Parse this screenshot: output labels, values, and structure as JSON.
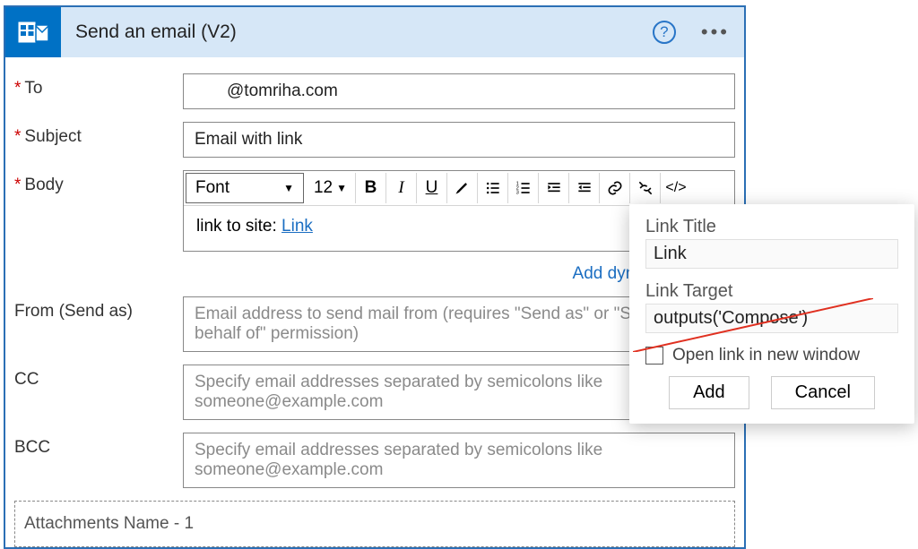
{
  "header": {
    "title": "Send an email (V2)"
  },
  "fields": {
    "to": {
      "label": "To",
      "value": "@tomriha.com"
    },
    "subject": {
      "label": "Subject",
      "value": "Email with link"
    },
    "body": {
      "label": "Body"
    },
    "from": {
      "label": "From (Send as)",
      "placeholder": "Email address to send mail from (requires \"Send as\" or \"Send on behalf of\" permission)"
    },
    "cc": {
      "label": "CC",
      "placeholder": "Specify email addresses separated by semicolons like someone@example.com"
    },
    "bcc": {
      "label": "BCC",
      "placeholder": "Specify email addresses separated by semicolons like someone@example.com"
    }
  },
  "toolbar": {
    "font": "Font",
    "size": "12"
  },
  "body_content": {
    "prefix": "link to site: ",
    "link_text": "Link"
  },
  "add_dynamic": "Add dynamic content",
  "attachments": {
    "label": "Attachments Name - 1"
  },
  "popup": {
    "title_label": "Link Title",
    "title_value": "Link",
    "target_label": "Link Target",
    "target_value": "outputs('Compose')",
    "open_new": "Open link in new window",
    "add": "Add",
    "cancel": "Cancel"
  }
}
